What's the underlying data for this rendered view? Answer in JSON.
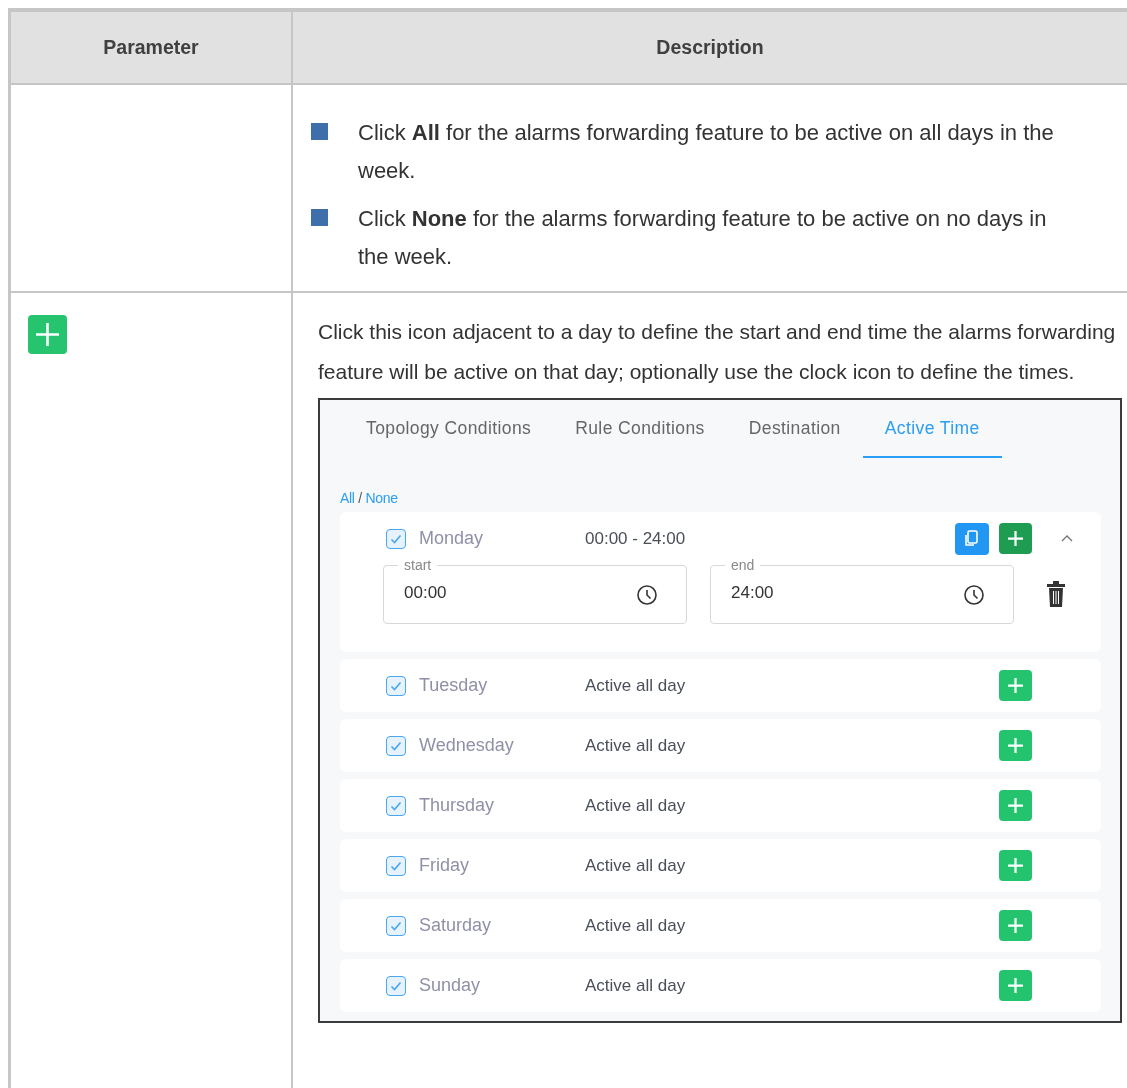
{
  "table": {
    "columns": [
      "Parameter",
      "Description"
    ],
    "rows": [
      {
        "kind": "bullets",
        "bullets": [
          "Click **All** for the alarms forwarding feature to be active on all days in the week.",
          "Click **None** for the alarms forwarding feature to be active on no days in the week."
        ]
      },
      {
        "kind": "add-icon",
        "description": "Click this icon adjacent to a day to define the start and end time the alarms forwarding feature will be active on that day; optionally use the clock icon to define the times.",
        "screenshot": {
          "tabs": [
            {
              "label": "Topology Conditions",
              "selected": false
            },
            {
              "label": "Rule Conditions",
              "selected": false
            },
            {
              "label": "Destination",
              "selected": false
            },
            {
              "label": "Active Time",
              "selected": true
            }
          ],
          "all_link": "All",
          "separator": "/",
          "none_link": "None",
          "days": [
            {
              "name": "Monday",
              "checked": true,
              "summary": "00:00 - 24:00",
              "expanded": true,
              "start_label": "start",
              "start": "00:00",
              "end_label": "end",
              "end": "24:00"
            },
            {
              "name": "Tuesday",
              "checked": true,
              "summary": "Active all day",
              "expanded": false
            },
            {
              "name": "Wednesday",
              "checked": true,
              "summary": "Active all day",
              "expanded": false
            },
            {
              "name": "Thursday",
              "checked": true,
              "summary": "Active all day",
              "expanded": false
            },
            {
              "name": "Friday",
              "checked": true,
              "summary": "Active all day",
              "expanded": false
            },
            {
              "name": "Saturday",
              "checked": true,
              "summary": "Active all day",
              "expanded": false
            },
            {
              "name": "Sunday",
              "checked": true,
              "summary": "Active all day",
              "expanded": false
            }
          ]
        }
      }
    ]
  }
}
